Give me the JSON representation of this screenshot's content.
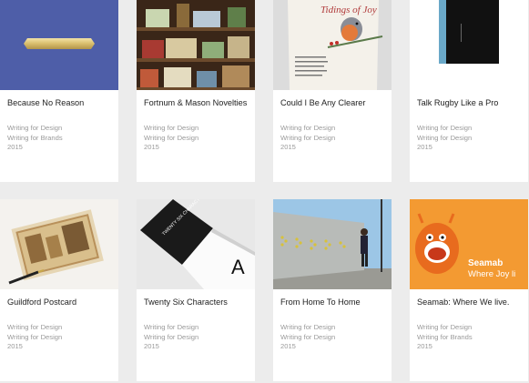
{
  "colors": {
    "page_bg": "#ececec",
    "card_bg": "#ffffff",
    "title_text": "#222222",
    "meta_text": "#9a9a9a"
  },
  "projects": [
    {
      "title": "Because No Reason",
      "categories": [
        "Writing for Design",
        "Writing for Brands"
      ],
      "year": "2015",
      "thumbnail": "blue-card-gold-plaque"
    },
    {
      "title": "Fortnum & Mason Novelties",
      "categories": [
        "Writing for Design",
        "Writing for Design"
      ],
      "year": "2015",
      "thumbnail": "shop-shelves-photo"
    },
    {
      "title": "Could I Be Any Clearer",
      "categories": [
        "Writing for Design",
        "Writing for Design"
      ],
      "year": "2015",
      "thumbnail": "robin-christmas-card",
      "thumbnail_text": "Tidings of Joy"
    },
    {
      "title": "Talk Rugby Like a Pro",
      "categories": [
        "Writing for Design",
        "Writing for Design"
      ],
      "year": "2015",
      "thumbnail": "black-blue-book-spine"
    },
    {
      "title": "Guildford Postcard",
      "categories": [
        "Writing for Design",
        "Writing for Design"
      ],
      "year": "2015",
      "thumbnail": "vintage-postcards-pen"
    },
    {
      "title": "Twenty Six Characters",
      "categories": [
        "Writing for Design",
        "Writing for Design"
      ],
      "year": "2015",
      "thumbnail": "open-book-letter-a",
      "thumbnail_text": "TWENTY SIX CHARACTERS"
    },
    {
      "title": "From Home To Home",
      "categories": [
        "Writing for Design",
        "Writing for Design"
      ],
      "year": "2015",
      "thumbnail": "street-hoarding-photo"
    },
    {
      "title": "Seamab: Where We live.",
      "categories": [
        "Writing for Design",
        "Writing for Brands"
      ],
      "year": "2015",
      "thumbnail": "orange-monster-illustration",
      "thumbnail_text": "Seamab",
      "thumbnail_subtext": "Where Joy li"
    }
  ]
}
